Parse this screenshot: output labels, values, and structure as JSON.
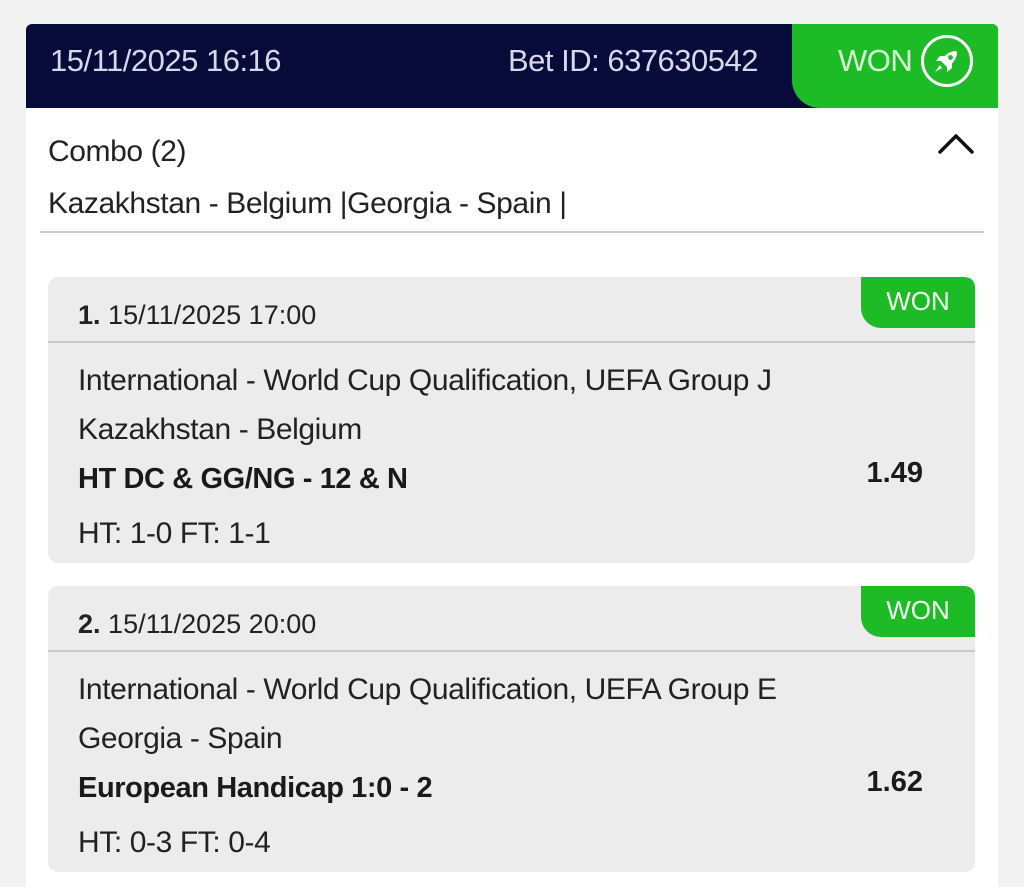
{
  "header": {
    "datetime": "15/11/2025 16:16",
    "bet_id": "Bet ID: 637630542",
    "status": "WON",
    "status_icon": "rocket-icon"
  },
  "summary": {
    "bet_type": "Combo (2)",
    "events": "Kazakhstan - Belgium |Georgia - Spain |",
    "collapse_icon": "chevron-up-icon"
  },
  "selections": [
    {
      "index": "1.",
      "datetime": "15/11/2025 17:00",
      "status": "WON",
      "competition": "International - World Cup Qualification, UEFA Group J",
      "match": "Kazakhstan - Belgium",
      "market": "HT DC & GG/NG - 12 & N",
      "odds": "1.49",
      "score": "HT: 1-0 FT: 1-1"
    },
    {
      "index": "2.",
      "datetime": "15/11/2025 20:00",
      "status": "WON",
      "competition": "International - World Cup Qualification, UEFA Group E",
      "match": "Georgia - Spain",
      "market": "European Handicap 1:0 - 2",
      "odds": "1.62",
      "score": "HT: 0-3 FT: 0-4"
    }
  ],
  "colors": {
    "header_bg": "#070b3a",
    "won_green": "#1dbc26"
  }
}
